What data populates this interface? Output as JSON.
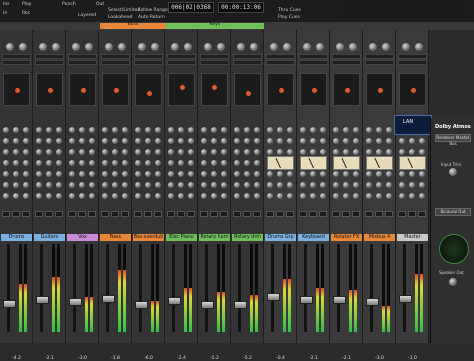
{
  "topbar": {
    "ins_label": "Ins",
    "punch_label": "Punch",
    "out_label": "Out",
    "play_label": "Play",
    "rec_label": "Rec",
    "in_label": "In",
    "layered_label": "Layered",
    "selection_label": "Select/Limited",
    "lookahead_label": "Lookahead",
    "follow_range_label": "Follow Range",
    "auto_return_label": "Auto Return",
    "counter_bars": "006|02|0368",
    "counter_time": "00:00:13:06",
    "thru_cues_label": "Thru Cues",
    "play_cues_label": "Play Cues"
  },
  "buses": [
    {
      "label": "Bass",
      "color": "#e8873a"
    },
    {
      "label": "Keys",
      "color": "#6fbf5a"
    }
  ],
  "strips": [
    {
      "name": "Drums",
      "color": "#7ab0e0",
      "volume": "-4.2",
      "fader_level": 0.32,
      "meter_level": 0.55,
      "pan_x": 0.5,
      "pan_y": 0.5,
      "type": "audio"
    },
    {
      "name": "Guitars",
      "color": "#7ab0e0",
      "volume": "-2.1",
      "fader_level": 0.36,
      "meter_level": 0.62,
      "pan_x": 0.5,
      "pan_y": 0.5,
      "type": "audio"
    },
    {
      "name": "Vox",
      "color": "#c98ad8",
      "volume": "-3.0",
      "fader_level": 0.34,
      "meter_level": 0.4,
      "pan_x": 0.5,
      "pan_y": 0.5,
      "type": "audio"
    },
    {
      "name": "Bass",
      "color": "#e8873a",
      "volume": "-1.8",
      "fader_level": 0.38,
      "meter_level": 0.7,
      "pan_x": 0.5,
      "pan_y": 0.5,
      "type": "audio"
    },
    {
      "name": "Bss overdub",
      "color": "#e8873a",
      "volume": "-6.0",
      "fader_level": 0.3,
      "meter_level": 0.35,
      "pan_x": 0.5,
      "pan_y": 0.6,
      "type": "audio"
    },
    {
      "name": "Elec Piano",
      "color": "#6fbf5a",
      "volume": "-2.4",
      "fader_level": 0.35,
      "meter_level": 0.5,
      "pan_x": 0.5,
      "pan_y": 0.4,
      "type": "audio"
    },
    {
      "name": "Rotary horn",
      "color": "#6fbf5a",
      "volume": "-5.2",
      "fader_level": 0.31,
      "meter_level": 0.45,
      "pan_x": 0.45,
      "pan_y": 0.4,
      "type": "audio"
    },
    {
      "name": "Rotary drm",
      "color": "#6fbf5a",
      "volume": "-5.2",
      "fader_level": 0.31,
      "meter_level": 0.42,
      "pan_x": 0.5,
      "pan_y": 0.6,
      "type": "audio"
    },
    {
      "name": "Drums Grp",
      "color": "#7ab0e0",
      "volume": "-0.4",
      "fader_level": 0.4,
      "meter_level": 0.6,
      "pan_x": 0.5,
      "pan_y": 0.5,
      "type": "aux"
    },
    {
      "name": "Keyboard",
      "color": "#7ab0e0",
      "volume": "-2.1",
      "fader_level": 0.36,
      "meter_level": 0.5,
      "pan_x": 0.5,
      "pan_y": 0.5,
      "type": "aux"
    },
    {
      "name": "Rotator FX",
      "color": "#e8873a",
      "volume": "-2.1",
      "fader_level": 0.36,
      "meter_level": 0.48,
      "pan_x": 0.5,
      "pan_y": 0.5,
      "type": "aux"
    },
    {
      "name": "Mixbus 4",
      "color": "#e8873a",
      "volume": "-3.0",
      "fader_level": 0.34,
      "meter_level": 0.3,
      "pan_x": 0.5,
      "pan_y": 0.5,
      "type": "aux"
    },
    {
      "name": "Master",
      "color": "#c8c8c8",
      "volume": "-1.0",
      "fader_level": 0.38,
      "meter_level": 0.66,
      "pan_x": 0.5,
      "pan_y": 0.5,
      "type": "aux"
    }
  ],
  "dolby": {
    "title": "Dolby Atmos",
    "renderer_label": "Renderer Master Bus",
    "input_trim_label": "Input Trim",
    "binaural_label": "Binaural Out",
    "speaker_out_label": "Speaker Out"
  },
  "lan_label": "LAN",
  "colors": {
    "accent_orange": "#e8873a",
    "accent_green": "#6fbf5a",
    "pan_dot": "#e05a2a",
    "name_blue": "#7ab0e0"
  }
}
